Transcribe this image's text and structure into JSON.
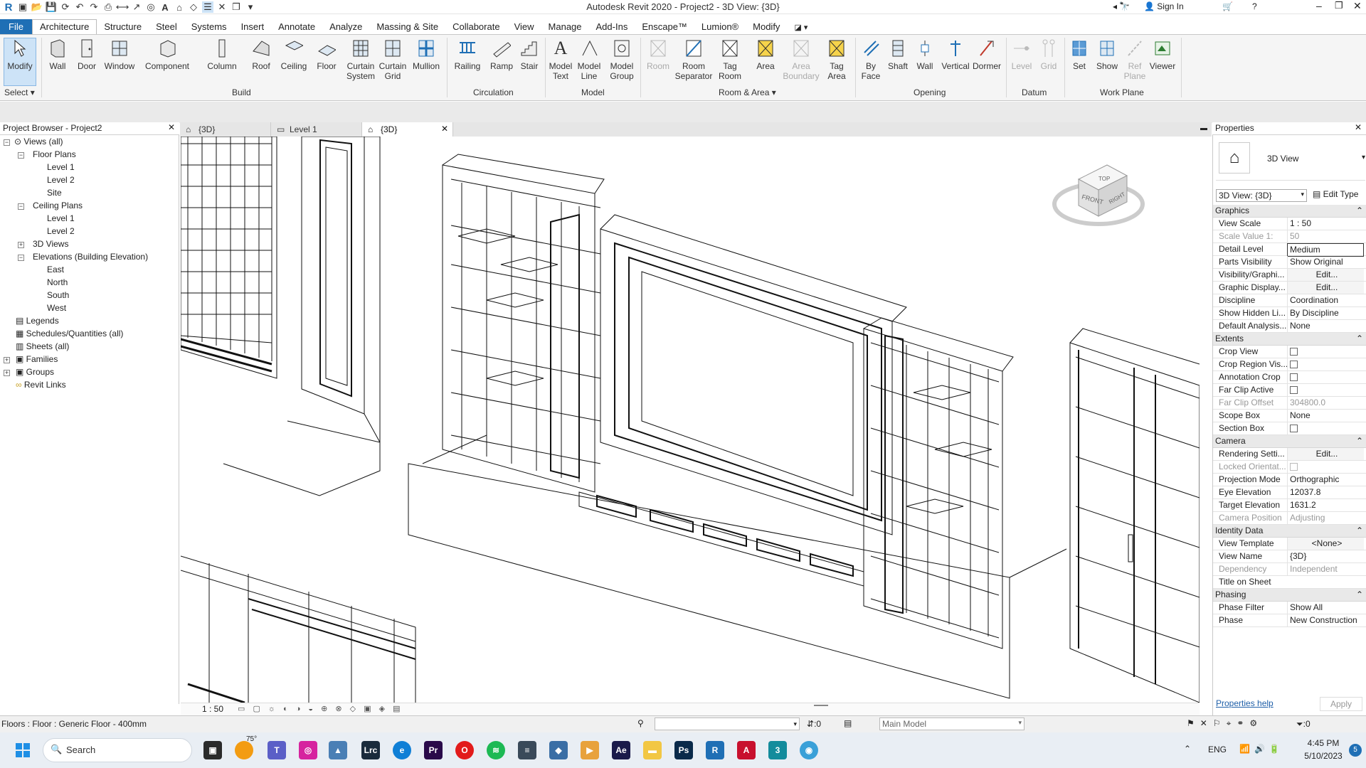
{
  "titlebar": {
    "title": "Autodesk Revit 2020 - Project2 - 3D View: {3D}",
    "sign_in": "Sign In"
  },
  "ribbon_tabs": [
    "File",
    "Architecture",
    "Structure",
    "Steel",
    "Systems",
    "Insert",
    "Annotate",
    "Analyze",
    "Massing & Site",
    "Collaborate",
    "View",
    "Manage",
    "Add-Ins",
    "Enscape™",
    "Lumion®",
    "Modify"
  ],
  "ribbon": {
    "modify": "Modify",
    "select": "Select",
    "build": {
      "label": "Build",
      "buttons": [
        "Wall",
        "Door",
        "Window",
        "Component",
        "Column",
        "Roof",
        "Ceiling",
        "Floor",
        "Curtain\nSystem",
        "Curtain\nGrid",
        "Mullion"
      ]
    },
    "circulation": {
      "label": "Circulation",
      "buttons": [
        "Railing",
        "Ramp",
        "Stair"
      ]
    },
    "model": {
      "label": "Model",
      "buttons": [
        "Model\nText",
        "Model\nLine",
        "Model\nGroup"
      ]
    },
    "room_area": {
      "label": "Room & Area",
      "buttons": [
        "Room",
        "Room\nSeparator",
        "Tag\nRoom",
        "Area",
        "Area\nBoundary",
        "Tag\nArea"
      ]
    },
    "opening": {
      "label": "Opening",
      "buttons": [
        "By\nFace",
        "Shaft",
        "Wall",
        "Vertical",
        "Dormer"
      ]
    },
    "datum": {
      "label": "Datum",
      "buttons": [
        "Level",
        "Grid"
      ]
    },
    "work_plane": {
      "label": "Work Plane",
      "buttons": [
        "Set",
        "Show",
        "Ref\nPlane",
        "Viewer"
      ]
    }
  },
  "project_browser": {
    "title": "Project Browser - Project2",
    "items": [
      "Views (all)",
      "Floor Plans",
      "Level 1",
      "Level 2",
      "Site",
      "Ceiling Plans",
      "Level 1",
      "Level 2",
      "3D Views",
      "Elevations (Building Elevation)",
      "East",
      "North",
      "South",
      "West",
      "Legends",
      "Schedules/Quantities (all)",
      "Sheets (all)",
      "Families",
      "Groups",
      "Revit Links"
    ]
  },
  "view_tabs": [
    "{3D}",
    "Level 1",
    "{3D}"
  ],
  "view_cube": {
    "top": "TOP",
    "front": "FRONT",
    "right": "RIGHT"
  },
  "view_control": {
    "scale": "1 : 50"
  },
  "properties": {
    "title": "Properties",
    "type_name": "3D View",
    "selector": "3D View: {3D}",
    "edit_type": "Edit Type",
    "sections": {
      "graphics": "Graphics",
      "extents": "Extents",
      "camera": "Camera",
      "identity": "Identity Data",
      "phasing": "Phasing"
    },
    "graphics_rows": [
      {
        "k": "View Scale",
        "v": "1 : 50"
      },
      {
        "k": "Scale Value    1:",
        "v": "50"
      },
      {
        "k": "Detail Level",
        "v": "Medium"
      },
      {
        "k": "Parts Visibility",
        "v": "Show Original"
      },
      {
        "k": "Visibility/Graphi...",
        "v": "Edit..."
      },
      {
        "k": "Graphic Display...",
        "v": "Edit..."
      },
      {
        "k": "Discipline",
        "v": "Coordination"
      },
      {
        "k": "Show Hidden Li...",
        "v": "By Discipline"
      },
      {
        "k": "Default Analysis...",
        "v": "None"
      }
    ],
    "extents_rows": [
      {
        "k": "Crop View",
        "v": ""
      },
      {
        "k": "Crop Region Vis...",
        "v": ""
      },
      {
        "k": "Annotation Crop",
        "v": ""
      },
      {
        "k": "Far Clip Active",
        "v": ""
      },
      {
        "k": "Far Clip Offset",
        "v": "304800.0"
      },
      {
        "k": "Scope Box",
        "v": "None"
      },
      {
        "k": "Section Box",
        "v": ""
      }
    ],
    "camera_rows": [
      {
        "k": "Rendering Setti...",
        "v": "Edit..."
      },
      {
        "k": "Locked Orientat...",
        "v": ""
      },
      {
        "k": "Projection Mode",
        "v": "Orthographic"
      },
      {
        "k": "Eye Elevation",
        "v": "12037.8"
      },
      {
        "k": "Target Elevation",
        "v": "1631.2"
      },
      {
        "k": "Camera Position",
        "v": "Adjusting"
      }
    ],
    "identity_rows": [
      {
        "k": "View Template",
        "v": "<None>"
      },
      {
        "k": "View Name",
        "v": "{3D}"
      },
      {
        "k": "Dependency",
        "v": "Independent"
      },
      {
        "k": "Title on Sheet",
        "v": ""
      }
    ],
    "phasing_rows": [
      {
        "k": "Phase Filter",
        "v": "Show All"
      },
      {
        "k": "Phase",
        "v": "New Construction"
      }
    ],
    "help": "Properties help",
    "apply": "Apply"
  },
  "status": {
    "text": "Floors : Floor : Generic Floor - 400mm",
    "worksets": ":0",
    "model": "Main Model",
    "filter": ":0"
  },
  "taskbar": {
    "search": "Search",
    "weather": "75°",
    "lang": "ENG",
    "time": "4:45 PM",
    "date": "5/10/2023"
  }
}
